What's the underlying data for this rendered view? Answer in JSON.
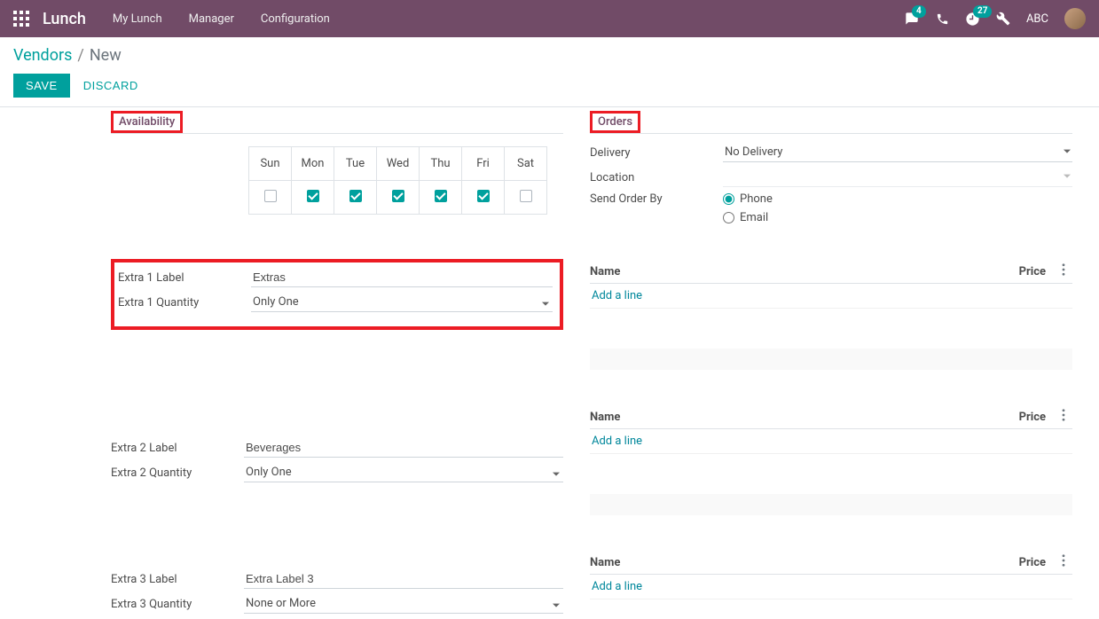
{
  "topnav": {
    "brand": "Lunch",
    "links": [
      "My Lunch",
      "Manager",
      "Configuration"
    ],
    "chat_badge": "4",
    "activity_badge": "27",
    "user_short": "ABC"
  },
  "breadcrumb": {
    "parent": "Vendors",
    "current": "New"
  },
  "actions": {
    "save": "SAVE",
    "discard": "DISCARD"
  },
  "availability": {
    "header": "Availability",
    "days": [
      "Sun",
      "Mon",
      "Tue",
      "Wed",
      "Thu",
      "Fri",
      "Sat"
    ],
    "checked": [
      false,
      true,
      true,
      true,
      true,
      true,
      false
    ]
  },
  "extras": [
    {
      "label_caption": "Extra 1 Label",
      "label_value": "Extras",
      "qty_caption": "Extra 1 Quantity",
      "qty_value": "Only One"
    },
    {
      "label_caption": "Extra 2 Label",
      "label_value": "Beverages",
      "qty_caption": "Extra 2 Quantity",
      "qty_value": "Only One"
    },
    {
      "label_caption": "Extra 3 Label",
      "label_value": "Extra Label 3",
      "qty_caption": "Extra 3 Quantity",
      "qty_value": "None or More"
    }
  ],
  "orders": {
    "header": "Orders",
    "delivery_label": "Delivery",
    "delivery_value": "No Delivery",
    "location_label": "Location",
    "location_value": "",
    "send_label": "Send Order By",
    "send_options": [
      "Phone",
      "Email"
    ],
    "send_selected": "Phone",
    "tables": [
      {
        "name_col": "Name",
        "price_col": "Price",
        "add_line": "Add a line"
      },
      {
        "name_col": "Name",
        "price_col": "Price",
        "add_line": "Add a line"
      },
      {
        "name_col": "Name",
        "price_col": "Price",
        "add_line": "Add a line"
      }
    ]
  }
}
